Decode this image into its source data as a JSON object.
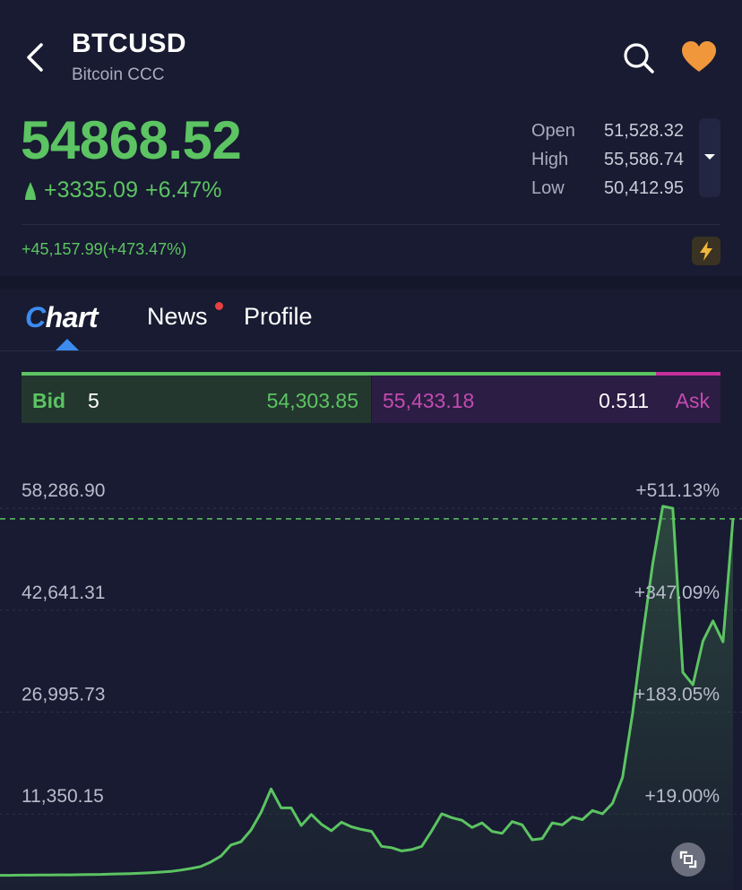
{
  "header": {
    "symbol": "BTCUSD",
    "name": "Bitcoin CCC"
  },
  "quote": {
    "price": "54868.52",
    "change": "+3335.09",
    "change_pct": "+6.47%",
    "open_label": "Open",
    "open": "51,528.32",
    "high_label": "High",
    "high": "55,586.74",
    "low_label": "Low",
    "low": "50,412.95",
    "ytd_change": "+45,157.99(+473.47%)"
  },
  "tabs": [
    {
      "label": "hart",
      "prefix": "C"
    },
    {
      "label": "News"
    },
    {
      "label": "Profile"
    }
  ],
  "bidask": {
    "bid_label": "Bid",
    "bid_size": "5",
    "bid_price": "54,303.85",
    "ask_price": "55,433.18",
    "ask_size": "0.511",
    "ask_label": "Ask"
  },
  "colors": {
    "background": "#181b31",
    "up": "#5cc462",
    "accent": "#3c8cf0",
    "ask": "#c44bb0",
    "favorite": "#f0973c"
  },
  "icons": {
    "back": "chevron-left-icon",
    "search": "search-icon",
    "favorite": "heart-icon",
    "expand": "caret-down-icon",
    "flash": "lightning-icon",
    "fullscreen": "fullscreen-icon"
  },
  "chart_data": {
    "type": "area",
    "y_tick_labels": [
      "58,286.90",
      "42,641.31",
      "26,995.73",
      "11,350.15"
    ],
    "y_ticks": [
      58286.9,
      42641.31,
      26995.73,
      11350.15
    ],
    "pct_tick_labels": [
      "+511.13%",
      "+347.09%",
      "+183.05%",
      "+19.00%"
    ],
    "current_price": 54868.52,
    "ylim": [
      -2100,
      61600
    ],
    "values": [
      150,
      150,
      180,
      180,
      200,
      200,
      220,
      230,
      250,
      280,
      300,
      350,
      380,
      420,
      480,
      560,
      650,
      750,
      950,
      1200,
      1500,
      2200,
      3100,
      4800,
      5300,
      7100,
      9800,
      13400,
      10500,
      10500,
      7800,
      9500,
      8000,
      7000,
      8300,
      7600,
      7200,
      6900,
      4600,
      4400,
      3900,
      4100,
      4600,
      7000,
      9600,
      9000,
      8600,
      7500,
      8200,
      6900,
      6600,
      8400,
      7900,
      5600,
      5800,
      8200,
      7900,
      9100,
      8700,
      10100,
      9600,
      11200,
      15200,
      25000,
      37000,
      48000,
      56800,
      56500,
      31300,
      29400,
      36100,
      39200,
      36000,
      55000
    ],
    "grid": "horizontal-dashed",
    "show_area_fill": true
  }
}
